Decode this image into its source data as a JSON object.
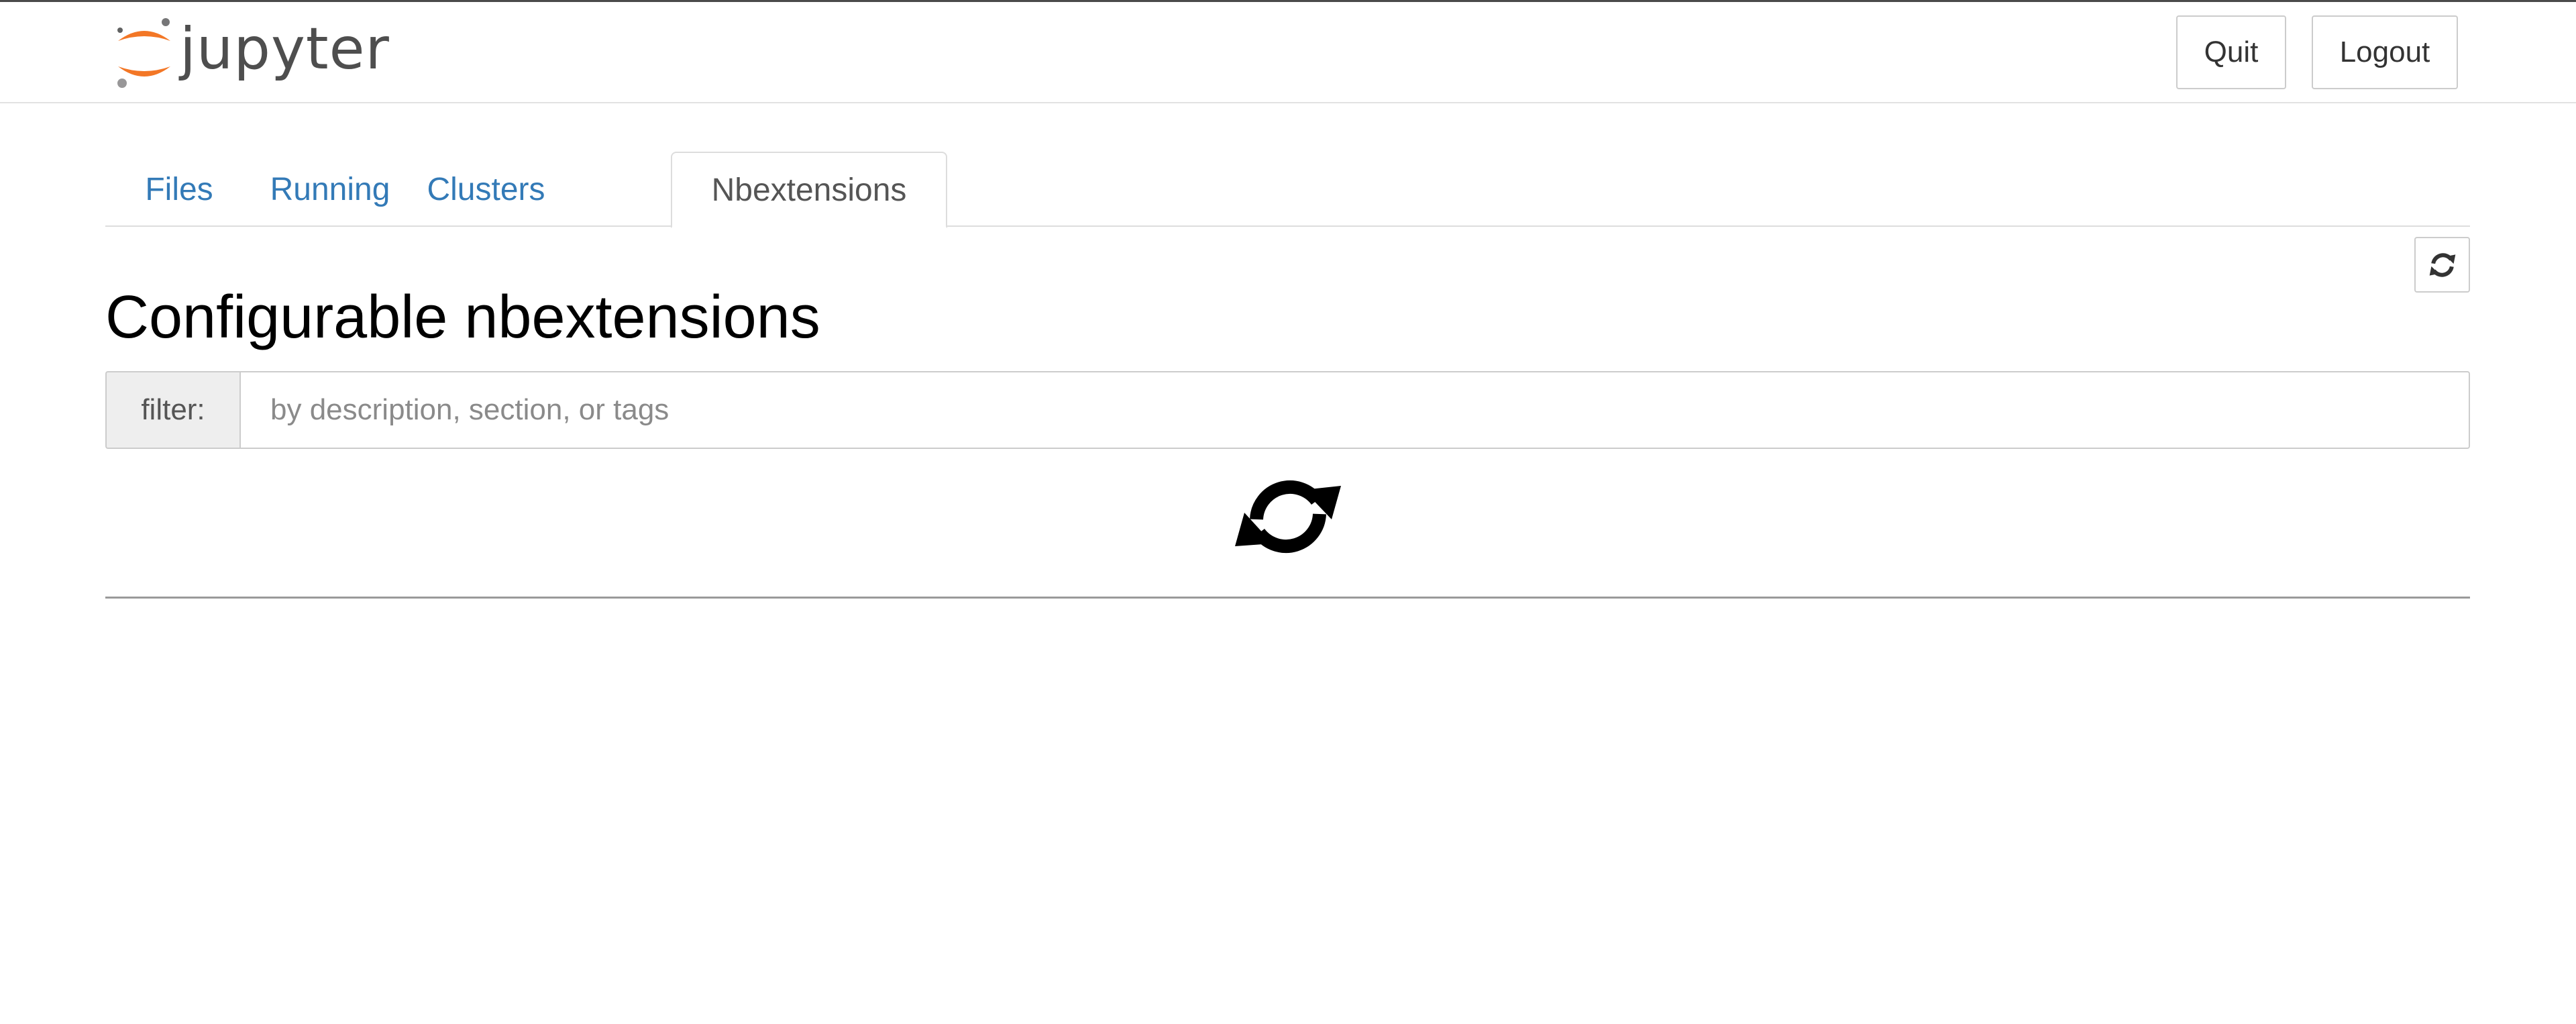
{
  "header": {
    "logo_text": "jupyter",
    "quit_label": "Quit",
    "logout_label": "Logout"
  },
  "tabs": [
    {
      "label": "Files",
      "active": false
    },
    {
      "label": "Running",
      "active": false
    },
    {
      "label": "Clusters",
      "active": false
    },
    {
      "label": "Nbextensions",
      "active": true
    }
  ],
  "main": {
    "title": "Configurable nbextensions",
    "filter": {
      "label": "filter:",
      "placeholder": "by description, section, or tags",
      "value": ""
    },
    "loading_icon": "refresh-spinner-icon",
    "refresh_icon": "refresh-icon"
  },
  "colors": {
    "link": "#337ab7",
    "jupyter_orange": "#f37726",
    "jupyter_gray": "#4e4e4e"
  }
}
